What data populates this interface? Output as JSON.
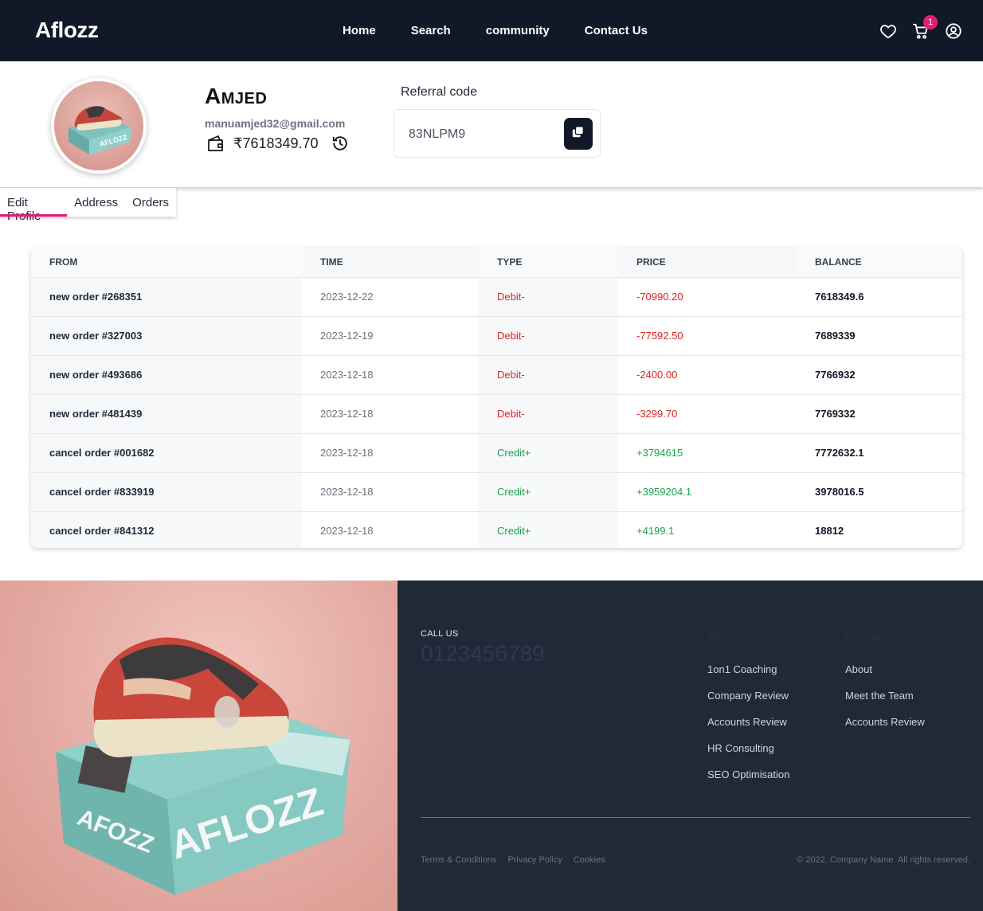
{
  "brand": "Aflozz",
  "nav": {
    "links": [
      "Home",
      "Search",
      "community",
      "Contact Us"
    ],
    "cart_count": "1",
    "icons": [
      "heart-icon",
      "cart-icon",
      "account-icon"
    ]
  },
  "profile": {
    "name": "Amjed",
    "email": "manuamjed32@gmail.com",
    "wallet_balance": "₹7618349.70",
    "referral_label": "Referral code",
    "referral_code": "83NLPM9"
  },
  "tabs": [
    "Edit Profile",
    "Address",
    "Orders"
  ],
  "active_tab": "Edit Profile",
  "table": {
    "headers": [
      "FROM",
      "TIME",
      "TYPE",
      "PRICE",
      "BALANCE"
    ],
    "rows": [
      {
        "from": "new order #268351",
        "time": "2023-12-22",
        "type": "Debit-",
        "price": "-70990.20",
        "balance": "7618349.6"
      },
      {
        "from": "new order #327003",
        "time": "2023-12-19",
        "type": "Debit-",
        "price": "-77592.50",
        "balance": "7689339"
      },
      {
        "from": "new order #493686",
        "time": "2023-12-18",
        "type": "Debit-",
        "price": "-2400.00",
        "balance": "7766932"
      },
      {
        "from": "new order #481439",
        "time": "2023-12-18",
        "type": "Debit-",
        "price": "-3299.70",
        "balance": "7769332"
      },
      {
        "from": "cancel order #001682",
        "time": "2023-12-18",
        "type": "Credit+",
        "price": "+3794615",
        "balance": "7772632.1"
      },
      {
        "from": "cancel order #833919",
        "time": "2023-12-18",
        "type": "Credit+",
        "price": "+3959204.1",
        "balance": "3978016.5"
      },
      {
        "from": "cancel order #841312",
        "time": "2023-12-18",
        "type": "Credit+",
        "price": "+4199.1",
        "balance": "18812"
      }
    ]
  },
  "footer": {
    "call_label": "CALL US",
    "call_number": "0123456789",
    "services_title": "Services",
    "services": [
      "1on1 Coaching",
      "Company Review",
      "Accounts Review",
      "HR Consulting",
      "SEO Optimisation"
    ],
    "company_title": "Company",
    "company": [
      "About",
      "Meet the Team",
      "Accounts Review"
    ],
    "legal": [
      "Terms & Conditions",
      "Privacy Policy",
      "Cookies"
    ],
    "copyright": "© 2022. Company Name. All rights reserved."
  },
  "colors": {
    "navbar": "#111827",
    "accent": "#e11d74",
    "debit": "#dc2626",
    "credit": "#16a34a",
    "footer": "#1f2937"
  }
}
